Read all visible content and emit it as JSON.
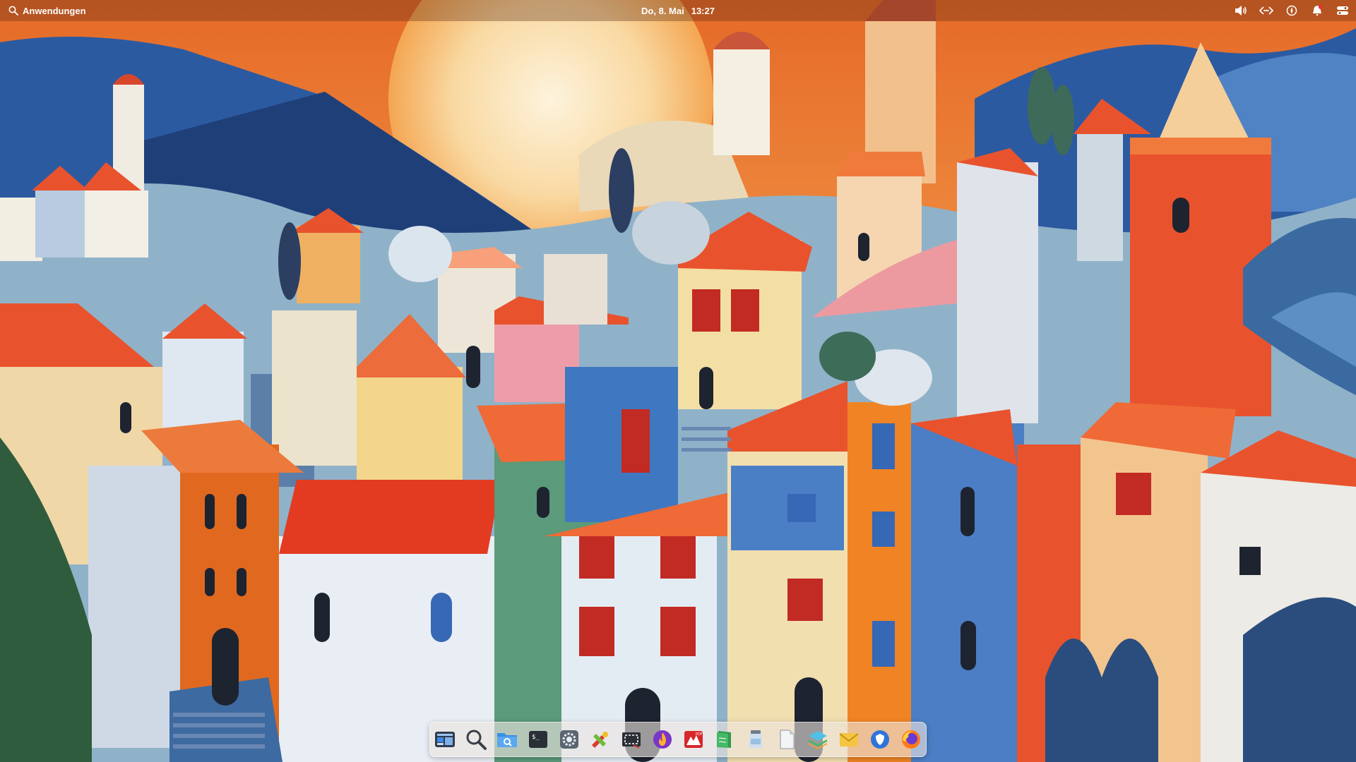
{
  "panel": {
    "launcher_label": "Anwendungen",
    "date": "Do,  8. Mai",
    "time": "13:27",
    "indicators": [
      {
        "name": "volume-icon"
      },
      {
        "name": "network-wired-icon"
      },
      {
        "name": "night-light-icon"
      },
      {
        "name": "notifications-icon",
        "has_badge": true
      },
      {
        "name": "session-icon"
      }
    ]
  },
  "dock": {
    "items": [
      {
        "name": "multitasking-view-icon",
        "tooltip": "Multitasking-Ansicht"
      },
      {
        "name": "search-icon",
        "tooltip": "Suche"
      },
      {
        "name": "files-icon",
        "tooltip": "Dateien"
      },
      {
        "name": "terminal-icon",
        "tooltip": "Terminal"
      },
      {
        "name": "system-settings-icon",
        "tooltip": "Systemeinstellungen"
      },
      {
        "name": "tools-icon",
        "tooltip": "Werkzeuge"
      },
      {
        "name": "screenshot-icon",
        "tooltip": "Bildschirmfoto"
      },
      {
        "name": "fire-app-icon",
        "tooltip": "App"
      },
      {
        "name": "pdf-reader-icon",
        "tooltip": "PDF"
      },
      {
        "name": "spreadsheet-icon",
        "tooltip": "Tabellen"
      },
      {
        "name": "jar-icon",
        "tooltip": "Speicher"
      },
      {
        "name": "document-icon",
        "tooltip": "Dokument"
      },
      {
        "name": "layers-icon",
        "tooltip": "Ebenen"
      },
      {
        "name": "mail-icon",
        "tooltip": "E-Mail"
      },
      {
        "name": "shield-browser-icon",
        "tooltip": "Browser"
      },
      {
        "name": "firefox-icon",
        "tooltip": "Firefox"
      }
    ]
  },
  "colors": {
    "panel_text": "#ffffff",
    "notification_badge": "#e8303a",
    "sky": "#f39a4a",
    "mountains": "#2c5aa0"
  }
}
